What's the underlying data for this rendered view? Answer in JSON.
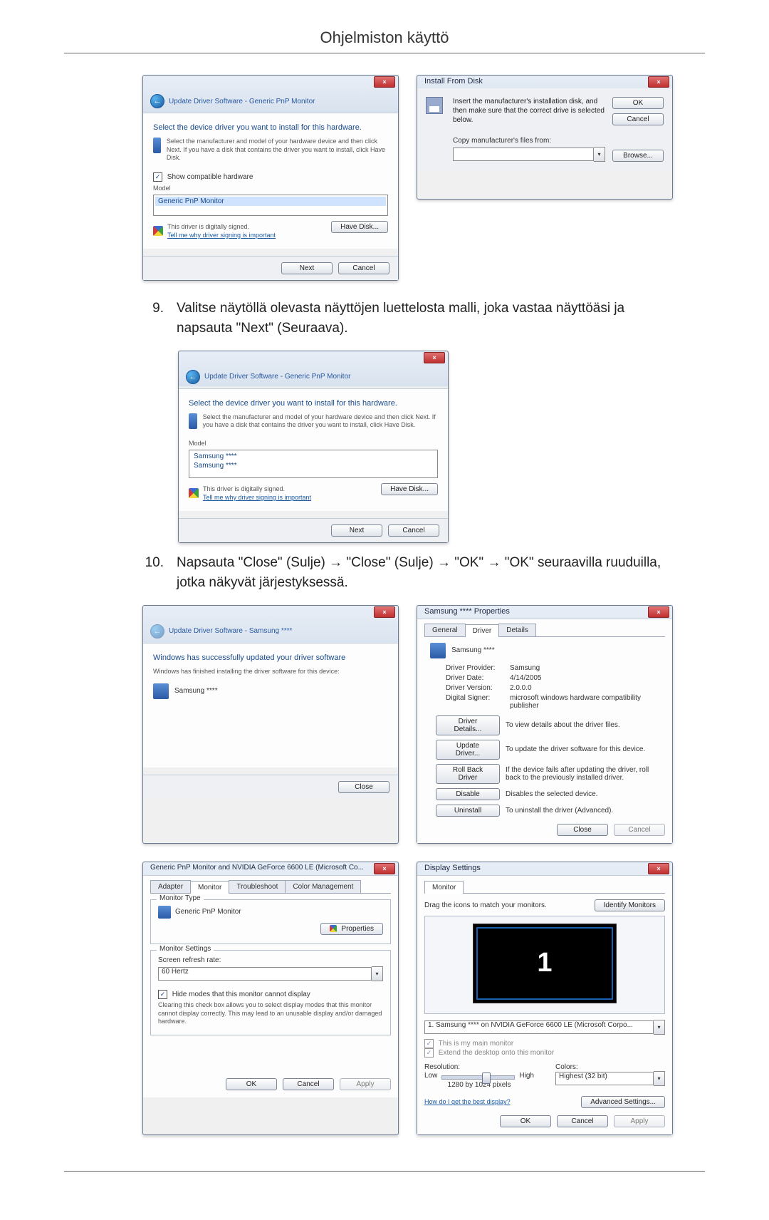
{
  "page_header": "Ohjelmiston käyttö",
  "step9": {
    "num": "9.",
    "text": "Valitse näytöllä olevasta näyttöjen luettelosta malli, joka vastaa näyttöäsi ja napsauta \"Next\" (Seuraava)."
  },
  "step10": {
    "num": "10.",
    "text": "Napsauta \"Close\" (Sulje) → \"Close\" (Sulje) → \"OK\" → \"OK\" seuraavilla ruuduilla, jotka näkyvät järjestyksessä."
  },
  "dlg_update1": {
    "breadcrumb": "Update Driver Software - Generic PnP Monitor",
    "instruction": "Select the device driver you want to install for this hardware.",
    "note": "Select the manufacturer and model of your hardware device and then click Next. If you have a disk that contains the driver you want to install, click Have Disk.",
    "show_compatible": "Show compatible hardware",
    "model_hdr": "Model",
    "model_item": "Generic PnP Monitor",
    "signed": "This driver is digitally signed.",
    "signed_link": "Tell me why driver signing is important",
    "have_disk": "Have Disk...",
    "next": "Next",
    "cancel": "Cancel"
  },
  "dlg_disk": {
    "title": "Install From Disk",
    "note": "Insert the manufacturer's installation disk, and then make sure that the correct drive is selected below.",
    "copy_label": "Copy manufacturer's files from:",
    "path": "",
    "ok": "OK",
    "cancel": "Cancel",
    "browse": "Browse..."
  },
  "dlg_update2": {
    "breadcrumb": "Update Driver Software - Generic PnP Monitor",
    "instruction": "Select the device driver you want to install for this hardware.",
    "note": "Select the manufacturer and model of your hardware device and then click Next. If you have a disk that contains the driver you want to install, click Have Disk.",
    "model_hdr": "Model",
    "model_item1": "Samsung ****",
    "model_item2": "Samsung ****",
    "signed": "This driver is digitally signed.",
    "signed_link": "Tell me why driver signing is important",
    "have_disk": "Have Disk...",
    "next": "Next",
    "cancel": "Cancel"
  },
  "dlg_finished": {
    "breadcrumb": "Update Driver Software - Samsung ****",
    "line1": "Windows has successfully updated your driver software",
    "line2": "Windows has finished installing the driver software for this device:",
    "device": "Samsung ****",
    "close": "Close"
  },
  "dlg_props": {
    "title": "Samsung **** Properties",
    "tab_general": "General",
    "tab_driver": "Driver",
    "tab_details": "Details",
    "device": "Samsung ****",
    "k_provider": "Driver Provider:",
    "v_provider": "Samsung",
    "k_date": "Driver Date:",
    "v_date": "4/14/2005",
    "k_version": "Driver Version:",
    "v_version": "2.0.0.0",
    "k_signer": "Digital Signer:",
    "v_signer": "microsoft windows hardware compatibility publisher",
    "b_details": "Driver Details...",
    "t_details": "To view details about the driver files.",
    "b_update": "Update Driver...",
    "t_update": "To update the driver software for this device.",
    "b_rollback": "Roll Back Driver",
    "t_rollback": "If the device fails after updating the driver, roll back to the previously installed driver.",
    "b_disable": "Disable",
    "t_disable": "Disables the selected device.",
    "b_uninstall": "Uninstall",
    "t_uninstall": "To uninstall the driver (Advanced).",
    "close": "Close",
    "cancel": "Cancel"
  },
  "dlg_adapter": {
    "title": "Generic PnP Monitor and NVIDIA GeForce 6600 LE (Microsoft Co...",
    "tab_adapter": "Adapter",
    "tab_monitor": "Monitor",
    "tab_trouble": "Troubleshoot",
    "tab_color": "Color Management",
    "grp_type": "Monitor Type",
    "monitor_name": "Generic PnP Monitor",
    "properties": "Properties",
    "grp_settings": "Monitor Settings",
    "refresh_label": "Screen refresh rate:",
    "refresh_value": "60 Hertz",
    "hide_modes": "Hide modes that this monitor cannot display",
    "hide_note": "Clearing this check box allows you to select display modes that this monitor cannot display correctly. This may lead to an unusable display and/or damaged hardware.",
    "ok": "OK",
    "cancel": "Cancel",
    "apply": "Apply"
  },
  "dlg_display": {
    "title": "Display Settings",
    "tab_monitor": "Monitor",
    "drag_text": "Drag the icons to match your monitors.",
    "identify": "Identify Monitors",
    "mon_num": "1",
    "monitor_sel": "1. Samsung **** on NVIDIA GeForce 6600 LE (Microsoft Corpo...",
    "main_mon": "This is my main monitor",
    "extend": "Extend the desktop onto this monitor",
    "res_label": "Resolution:",
    "res_low": "Low",
    "res_high": "High",
    "res_value": "1280 by 1024 pixels",
    "colors_label": "Colors:",
    "colors_value": "Highest (32 bit)",
    "best_link": "How do I get the best display?",
    "advanced": "Advanced Settings...",
    "ok": "OK",
    "cancel": "Cancel",
    "apply": "Apply"
  }
}
